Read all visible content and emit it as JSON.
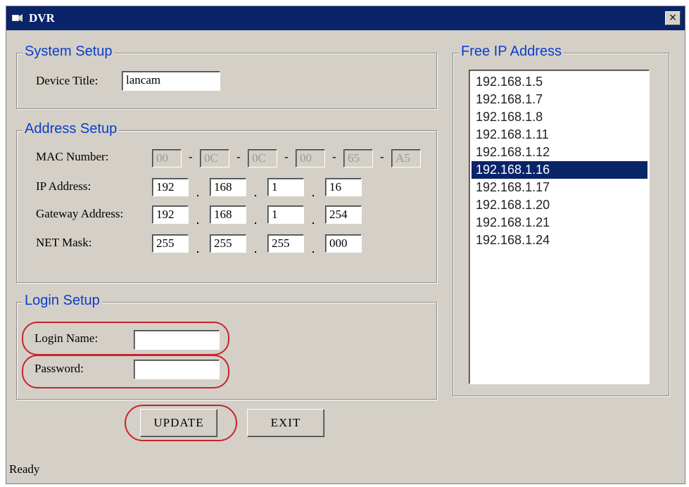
{
  "window": {
    "title": "DVR",
    "close_label": "×"
  },
  "system_setup": {
    "legend": "System Setup",
    "device_title_label": "Device Title:",
    "device_title_value": "lancam"
  },
  "address_setup": {
    "legend": "Address Setup",
    "mac_label": "MAC Number:",
    "mac": [
      "00",
      "0C",
      "0C",
      "00",
      "65",
      "A5"
    ],
    "ip_label": "IP Address:",
    "ip": [
      "192",
      "168",
      "1",
      "16"
    ],
    "gateway_label": "Gateway Address:",
    "gateway": [
      "192",
      "168",
      "1",
      "254"
    ],
    "netmask_label": "NET Mask:",
    "netmask": [
      "255",
      "255",
      "255",
      "000"
    ]
  },
  "login_setup": {
    "legend": "Login Setup",
    "login_name_label": "Login Name:",
    "login_name_value": "",
    "password_label": "Password:",
    "password_value": ""
  },
  "buttons": {
    "update": "UPDATE",
    "exit": "EXIT"
  },
  "free_ip": {
    "legend": "Free IP Address",
    "items": [
      "192.168.1.5",
      "192.168.1.7",
      "192.168.1.8",
      "192.168.1.11",
      "192.168.1.12",
      "192.168.1.16",
      "192.168.1.17",
      "192.168.1.20",
      "192.168.1.21",
      "192.168.1.24"
    ],
    "selected": "192.168.1.16"
  },
  "status": "Ready",
  "colors": {
    "titlebar": "#0a246a",
    "legend": "#0b3ec8",
    "annotation": "#c8242a",
    "face": "#d4d0c8"
  }
}
